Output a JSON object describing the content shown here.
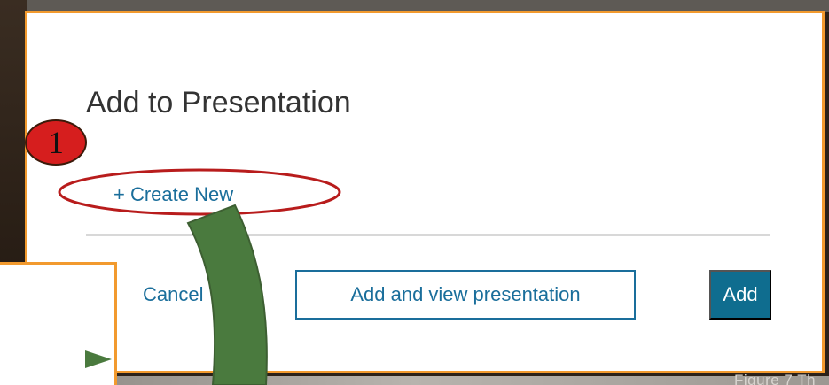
{
  "dialog": {
    "title": "Add to Presentation",
    "create_new_label": "+ Create New",
    "cancel_label": "Cancel",
    "view_presentation_label": "Add and view presentation",
    "add_label": "Add"
  },
  "annotation": {
    "step_number": "1",
    "highlight_color": "#b81c1c",
    "arrow_color": "#4a7a3e",
    "badge_color": "#d61e1e"
  },
  "background": {
    "partial_caption": "Figure 7 Th"
  },
  "colors": {
    "accent_border": "#f29a2e",
    "link": "#1a6e9b",
    "primary_button": "#0f6d8f"
  }
}
